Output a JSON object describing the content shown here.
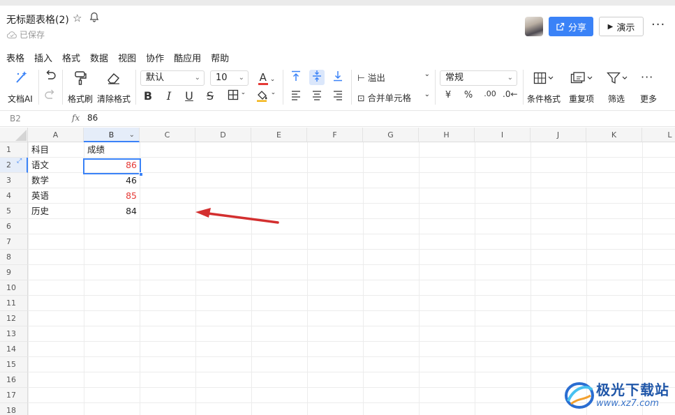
{
  "document": {
    "title": "无标题表格(2)",
    "saved_status": "已保存"
  },
  "header": {
    "share_label": "分享",
    "present_label": "演示",
    "more_label": "···"
  },
  "menu": [
    "表格",
    "插入",
    "格式",
    "数据",
    "视图",
    "协作",
    "酷应用",
    "帮助"
  ],
  "toolbar": {
    "ai_label": "文档AI",
    "format_painter_label": "格式刷",
    "clear_format_label": "清除格式",
    "font_family": "默认",
    "font_size": "10",
    "wrap_label": "溢出",
    "merge_label": "合并单元格",
    "number_format": "常规",
    "currency_symbol": "¥",
    "percent_symbol": "%",
    "decimal_label": ".00",
    "conditional_format_label": "条件格式",
    "duplicates_label": "重复项",
    "filter_label": "筛选",
    "more_label": "更多"
  },
  "formula_bar": {
    "cell_ref": "B2",
    "fx": "fx",
    "value": "86"
  },
  "sheet": {
    "columns": [
      "A",
      "B",
      "C",
      "D",
      "E",
      "F",
      "G",
      "H",
      "I",
      "J",
      "K",
      "L"
    ],
    "rows": [
      "1",
      "2",
      "3",
      "4",
      "5",
      "6",
      "7",
      "8",
      "9",
      "10",
      "11",
      "12",
      "13",
      "14",
      "15",
      "16",
      "17",
      "18"
    ],
    "selected_cell": "B2",
    "cells": {
      "A1": "科目",
      "B1": "成绩",
      "A2": "语文",
      "B2": "86",
      "A3": "数学",
      "B3": "46",
      "A4": "英语",
      "B4": "85",
      "A5": "历史",
      "B5": "84"
    },
    "highlight_color": "#e53935"
  },
  "watermark": {
    "title": "极光下载站",
    "url": "www.xz7.com"
  },
  "colors": {
    "accent": "#3a82f7",
    "annotation_arrow": "#d32f2f"
  }
}
